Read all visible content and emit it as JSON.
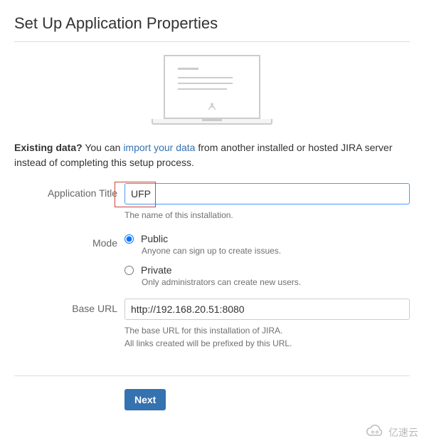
{
  "page_title": "Set Up Application Properties",
  "existing_data": {
    "prefix_bold": "Existing data?",
    "text_before_link": " You can ",
    "link_text": "import your data",
    "text_after_link": " from another installed or hosted JIRA server instead of completing this setup process."
  },
  "fields": {
    "app_title": {
      "label": "Application Title",
      "value": "UFP",
      "help": "The name of this installation."
    },
    "mode": {
      "label": "Mode",
      "options": {
        "public": {
          "label": "Public",
          "help": "Anyone can sign up to create issues.",
          "checked": true
        },
        "private": {
          "label": "Private",
          "help": "Only administrators can create new users.",
          "checked": false
        }
      }
    },
    "base_url": {
      "label": "Base URL",
      "value": "http://192.168.20.51:8080",
      "help_line1": "The base URL for this installation of JIRA.",
      "help_line2": "All links created will be prefixed by this URL."
    }
  },
  "buttons": {
    "next": "Next"
  },
  "watermark": "亿速云"
}
